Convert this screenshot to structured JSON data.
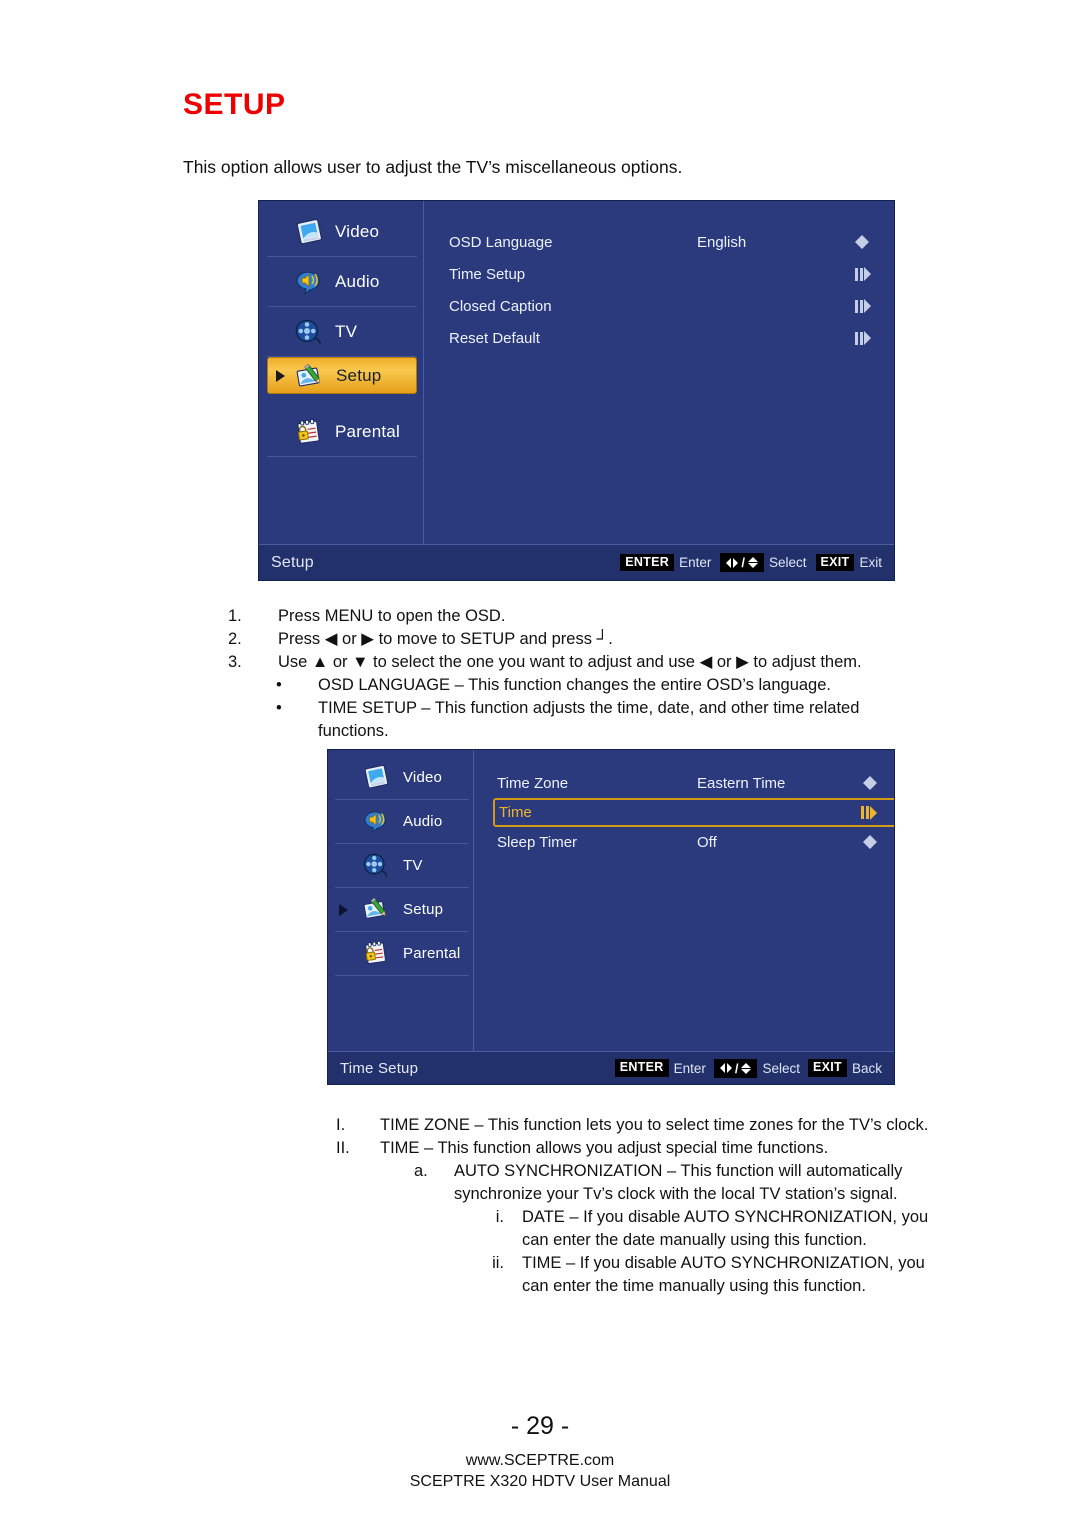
{
  "page": {
    "heading": "SETUP",
    "intro": "This option allows user to adjust the TV’s miscellaneous options.",
    "page_number": "- 29 -",
    "website": "www.SCEPTRE.com",
    "manual_line": "SCEPTRE X320 HDTV User Manual"
  },
  "colors": {
    "heading_red": "#ee0000",
    "osd_background": "#2a3a7c",
    "osd_footer": "#22316b",
    "osd_divider": "#4256a0",
    "highlight_gold": "#f0b42c",
    "highlight_border": "#d39a18",
    "glyph_gray": "#c6cde6",
    "badge_black": "#000000",
    "text_white": "#ffffff"
  },
  "osd_setup": {
    "sidebar": [
      {
        "label": "Video",
        "icon": "video-monitor-icon",
        "selected": false,
        "pointer": false
      },
      {
        "label": "Audio",
        "icon": "audio-speaker-icon",
        "selected": false,
        "pointer": false
      },
      {
        "label": "TV",
        "icon": "tv-film-reel-icon",
        "selected": false,
        "pointer": false
      },
      {
        "label": "Setup",
        "icon": "setup-pencil-icon",
        "selected": true,
        "pointer": true
      },
      {
        "label": "Parental",
        "icon": "parental-lock-icon",
        "selected": false,
        "pointer": false
      }
    ],
    "rows": [
      {
        "label": "OSD Language",
        "value": "English",
        "control": "left-right-arrows",
        "highlight": false
      },
      {
        "label": "Time Setup",
        "value": "",
        "control": "bars-right-arrow",
        "highlight": false
      },
      {
        "label": "Closed Caption",
        "value": "",
        "control": "bars-right-arrow",
        "highlight": false
      },
      {
        "label": "Reset Default",
        "value": "",
        "control": "bars-right-arrow",
        "highlight": false
      }
    ],
    "footer": {
      "title": "Setup",
      "hints": [
        {
          "badge": "ENTER",
          "badge_type": "text",
          "text": "Enter"
        },
        {
          "badge": "",
          "badge_type": "symbol",
          "text": "Select"
        },
        {
          "badge": "EXIT",
          "badge_type": "text",
          "text": "Exit"
        }
      ]
    }
  },
  "osd_time_setup": {
    "sidebar": [
      {
        "label": "Video",
        "icon": "video-monitor-icon",
        "selected": false,
        "pointer": false
      },
      {
        "label": "Audio",
        "icon": "audio-speaker-icon",
        "selected": false,
        "pointer": false
      },
      {
        "label": "TV",
        "icon": "tv-film-reel-icon",
        "selected": false,
        "pointer": false
      },
      {
        "label": "Setup",
        "icon": "setup-pencil-icon",
        "selected": false,
        "pointer": true
      },
      {
        "label": "Parental",
        "icon": "parental-lock-icon",
        "selected": false,
        "pointer": false
      }
    ],
    "rows": [
      {
        "label": "Time Zone",
        "value": "Eastern Time",
        "control": "left-right-arrows",
        "highlight": false
      },
      {
        "label": "Time",
        "value": "",
        "control": "bars-right-arrow",
        "highlight": true
      },
      {
        "label": "Sleep Timer",
        "value": "Off",
        "control": "left-right-arrows",
        "highlight": false
      }
    ],
    "footer": {
      "title": "Time Setup",
      "hints": [
        {
          "badge": "ENTER",
          "badge_type": "text",
          "text": "Enter"
        },
        {
          "badge": "",
          "badge_type": "symbol",
          "text": "Select"
        },
        {
          "badge": "EXIT",
          "badge_type": "text",
          "text": "Back"
        }
      ]
    }
  },
  "steps": [
    {
      "marker": "1.",
      "text": "Press MENU to open the OSD.",
      "indent": 0
    },
    {
      "marker": "2.",
      "text": "Press ◀ or ▶ to move to SETUP and press ┘.",
      "indent": 0
    },
    {
      "marker": "3.",
      "text": "Use ▲ or ▼ to select the one you want to adjust and use ◀ or ▶ to adjust them.",
      "indent": 0
    },
    {
      "marker": "•",
      "text": "OSD LANGUAGE – This function changes the entire OSD’s language.",
      "indent": 1
    },
    {
      "marker": "•",
      "text": "TIME SETUP – This function adjusts the time, date, and other time related",
      "indent": 1
    },
    {
      "marker": "",
      "text": "functions.",
      "indent": 2
    }
  ],
  "details": [
    {
      "marker": "I.",
      "text": "TIME ZONE – This function lets you to select time zones for the TV’s clock.",
      "level": 0
    },
    {
      "marker": "II.",
      "text": "TIME – This function allows you adjust special time functions.",
      "level": 0
    },
    {
      "marker": "a.",
      "text": "AUTO SYNCHRONIZATION – This function will automatically",
      "level": 1
    },
    {
      "marker": "",
      "text": "synchronize your Tv’s clock with the local TV station’s signal.",
      "level": 2
    },
    {
      "marker": "i.",
      "text": "DATE – If you disable AUTO SYNCHRONIZATION, you",
      "level": 3
    },
    {
      "marker": "",
      "text": "can enter the date manually using this function.",
      "level": 4
    },
    {
      "marker": "ii.",
      "text": "TIME – If you disable AUTO SYNCHRONIZATION, you",
      "level": 3
    },
    {
      "marker": "",
      "text": "can enter the time manually using this function.",
      "level": 4
    }
  ]
}
